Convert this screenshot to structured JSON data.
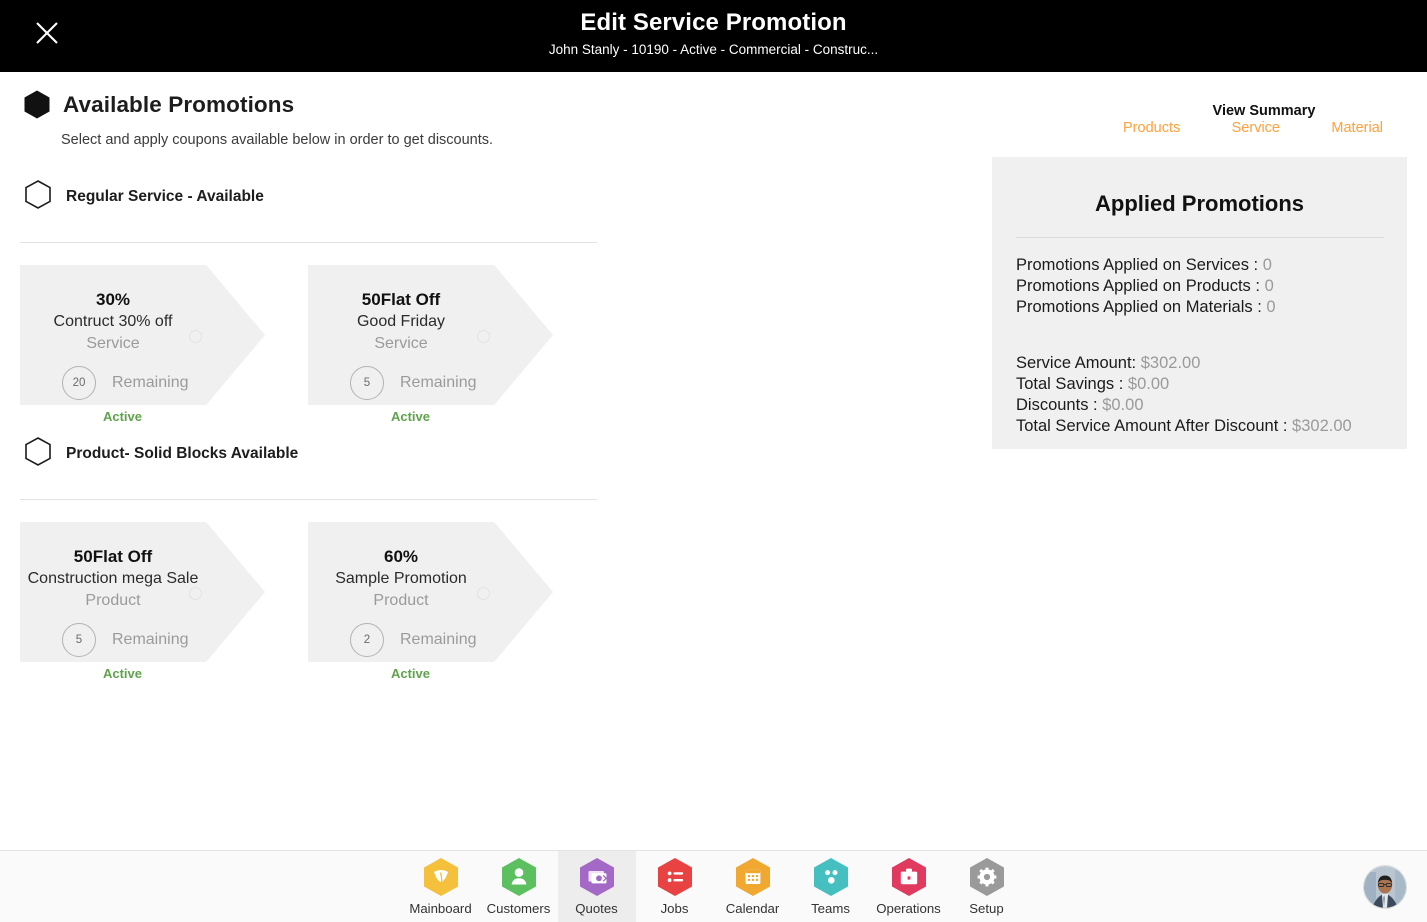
{
  "header": {
    "close_icon": "close-icon",
    "title": "Edit Service Promotion",
    "subtitle": "John Stanly - 10190 - Active - Commercial - Construc..."
  },
  "page": {
    "icon": "hexagon-solid-icon",
    "title": "Available Promotions",
    "subtitle": "Select and apply coupons available below in order to get discounts."
  },
  "summary": {
    "label": "View Summary",
    "links": [
      {
        "label": "Products",
        "name": "summary-link-products"
      },
      {
        "label": "Service",
        "name": "summary-link-service"
      },
      {
        "label": "Material",
        "name": "summary-link-material"
      }
    ],
    "accent_color": "#FFA13C"
  },
  "sections": [
    {
      "title": "Regular Service - Available",
      "icon": "hexagon-outline-icon",
      "coupons": [
        {
          "amount": "30%",
          "name": "Contruct 30% off",
          "type": "Service",
          "count": "20",
          "remaining_label": "Remaining",
          "status": "Active",
          "status_color": "#5FA34C"
        },
        {
          "amount": "50Flat Off",
          "name": "Good Friday",
          "type": "Service",
          "count": "5",
          "remaining_label": "Remaining",
          "status": "Active",
          "status_color": "#5FA34C"
        }
      ]
    },
    {
      "title": "Product- Solid Blocks Available",
      "icon": "hexagon-outline-icon",
      "coupons": [
        {
          "amount": "50Flat Off",
          "name": "Construction mega Sale",
          "type": "Product",
          "count": "5",
          "remaining_label": "Remaining",
          "status": "Active",
          "status_color": "#5FA34C"
        },
        {
          "amount": "60%",
          "name": "Sample Promotion",
          "type": "Product",
          "count": "2",
          "remaining_label": "Remaining",
          "status": "Active",
          "status_color": "#5FA34C"
        }
      ]
    }
  ],
  "applied": {
    "title": "Applied Promotions",
    "counts": [
      {
        "label": "Promotions Applied on Services : ",
        "value": "0"
      },
      {
        "label": "Promotions Applied on Products : ",
        "value": "0"
      },
      {
        "label": "Promotions Applied on Materials : ",
        "value": "0"
      }
    ],
    "amounts": [
      {
        "label": "Service Amount: ",
        "value": "$302.00"
      },
      {
        "label": "Total Savings : ",
        "value": "$0.00"
      },
      {
        "label": "Discounts : ",
        "value": "$0.00"
      },
      {
        "label": "Total Service Amount After Discount : ",
        "value": "$302.00"
      }
    ]
  },
  "bottom_nav": {
    "items": [
      {
        "label": "Mainboard",
        "icon": "dashboard-icon",
        "color": "#F5C13C",
        "active": false
      },
      {
        "label": "Customers",
        "icon": "person-icon",
        "color": "#5CBF60",
        "active": false
      },
      {
        "label": "Quotes",
        "icon": "quote-icon",
        "color": "#A469C6",
        "active": true
      },
      {
        "label": "Jobs",
        "icon": "list-icon",
        "color": "#E84242",
        "active": false
      },
      {
        "label": "Calendar",
        "icon": "calendar-icon",
        "color": "#F0A830",
        "active": false
      },
      {
        "label": "Teams",
        "icon": "teams-icon",
        "color": "#45BFBF",
        "active": false
      },
      {
        "label": "Operations",
        "icon": "briefcase-icon",
        "color": "#E03A5F",
        "active": false
      },
      {
        "label": "Setup",
        "icon": "gear-icon",
        "color": "#9A9A9A",
        "active": false
      }
    ],
    "avatar": "user-avatar"
  }
}
